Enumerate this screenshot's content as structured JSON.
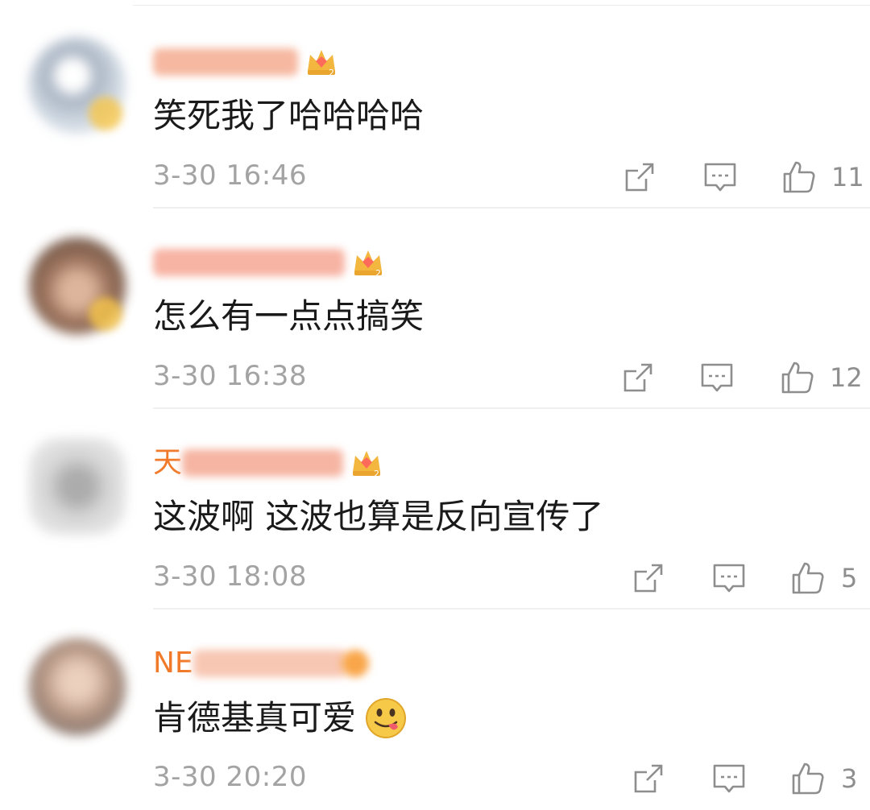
{
  "colors": {
    "username": "#f07a2a",
    "text": "#1a1a1a",
    "meta": "#a3a3a3",
    "icon": "#8e8e8e",
    "divider": "#efefef"
  },
  "comments": [
    {
      "username_visible": "",
      "text": "笑死我了哈哈哈哈",
      "time": "3-30 16:46",
      "likes": "11",
      "has_crown": true,
      "has_emoji": false
    },
    {
      "username_visible": "",
      "text": "怎么有一点点搞笑",
      "time": "3-30 16:38",
      "likes": "12",
      "has_crown": true,
      "has_emoji": false
    },
    {
      "username_visible": "天",
      "text": "这波啊 这波也算是反向宣传了",
      "time": "3-30 18:08",
      "likes": "5",
      "has_crown": true,
      "has_emoji": false
    },
    {
      "username_visible": "NE",
      "text": "肯德基真可爱",
      "time": "3-30 20:20",
      "likes": "3",
      "has_crown": false,
      "has_emoji": true
    }
  ],
  "icons": {
    "share": "share-icon",
    "reply": "comment-icon",
    "like": "thumbs-up-icon",
    "badge": "crown-badge-icon",
    "emoji": "tongue-out-emoji-icon"
  }
}
